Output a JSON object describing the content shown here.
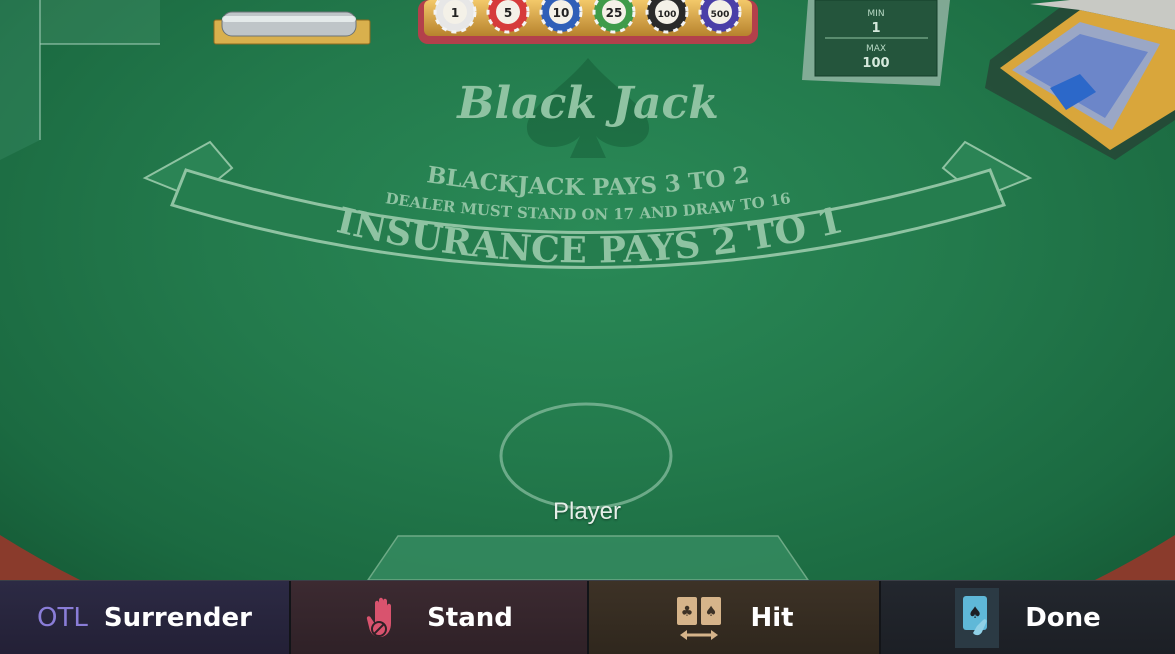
{
  "felt": {
    "title": "Black Jack",
    "line1": "BLACKJACK PAYS 3 TO 2",
    "line2": "DEALER MUST STAND ON 17 AND DRAW TO 16",
    "line3": "INSURANCE PAYS 2 TO 1"
  },
  "chips": [
    "1",
    "5",
    "10",
    "25",
    "100",
    "500"
  ],
  "limits": {
    "min_label": "MIN",
    "min_value": "1",
    "max_label": "MAX",
    "max_value": "100"
  },
  "player_label": "Player",
  "actions": {
    "surrender_prefix": "OTL",
    "surrender": "Surrender",
    "stand": "Stand",
    "hit": "Hit",
    "done": "Done"
  },
  "icons": {
    "stand": "hand-stop-icon",
    "hit": "cards-hit-icon",
    "done": "card-done-icon"
  },
  "colors": {
    "felt": "#237a4c",
    "felt_text": "#8fc3a2",
    "surrender_accent": "#8a7dd8",
    "stand_icon": "#d9536e",
    "hit_icon": "#d6b48a",
    "done_icon": "#5fb8d8"
  }
}
